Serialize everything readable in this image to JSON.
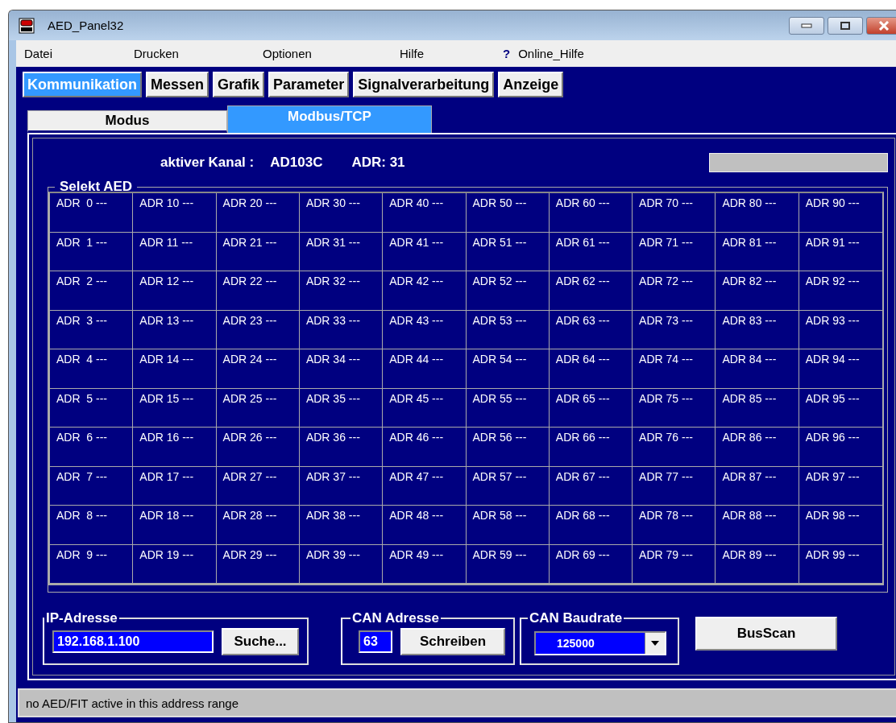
{
  "window": {
    "title": "AED_Panel32"
  },
  "menu": [
    "Datei",
    "Drucken",
    "Optionen",
    "Hilfe"
  ],
  "help_item": {
    "mark": "?",
    "label": "Online_Hilfe"
  },
  "main_tabs": [
    {
      "label": "Kommunikation",
      "selected": true
    },
    {
      "label": "Messen",
      "selected": false
    },
    {
      "label": "Grafik",
      "selected": false
    },
    {
      "label": "Parameter",
      "selected": false
    },
    {
      "label": "Signalverarbeitung",
      "selected": false
    },
    {
      "label": "Anzeige",
      "selected": false
    }
  ],
  "sub_tabs": [
    {
      "label": "Modus",
      "selected": false
    },
    {
      "label": "Modbus/TCP",
      "selected": true
    }
  ],
  "active_channel": {
    "label": "aktiver Kanal :",
    "channel": "AD103C",
    "address": "ADR: 31"
  },
  "address_grid": {
    "title": "Selekt AED",
    "rows": [
      [
        "ADR  0 ---",
        "ADR 10 ---",
        "ADR 20 ---",
        "ADR 30 ---",
        "ADR 40 ---",
        "ADR 50 ---",
        "ADR 60 ---",
        "ADR 70 ---",
        "ADR 80 ---",
        "ADR 90 ---"
      ],
      [
        "ADR  1 ---",
        "ADR 11 ---",
        "ADR 21 ---",
        "ADR 31 ---",
        "ADR 41 ---",
        "ADR 51 ---",
        "ADR 61 ---",
        "ADR 71 ---",
        "ADR 81 ---",
        "ADR 91 ---"
      ],
      [
        "ADR  2 ---",
        "ADR 12 ---",
        "ADR 22 ---",
        "ADR 32 ---",
        "ADR 42 ---",
        "ADR 52 ---",
        "ADR 62 ---",
        "ADR 72 ---",
        "ADR 82 ---",
        "ADR 92 ---"
      ],
      [
        "ADR  3 ---",
        "ADR 13 ---",
        "ADR 23 ---",
        "ADR 33 ---",
        "ADR 43 ---",
        "ADR 53 ---",
        "ADR 63 ---",
        "ADR 73 ---",
        "ADR 83 ---",
        "ADR 93 ---"
      ],
      [
        "ADR  4 ---",
        "ADR 14 ---",
        "ADR 24 ---",
        "ADR 34 ---",
        "ADR 44 ---",
        "ADR 54 ---",
        "ADR 64 ---",
        "ADR 74 ---",
        "ADR 84 ---",
        "ADR 94 ---"
      ],
      [
        "ADR  5 ---",
        "ADR 15 ---",
        "ADR 25 ---",
        "ADR 35 ---",
        "ADR 45 ---",
        "ADR 55 ---",
        "ADR 65 ---",
        "ADR 75 ---",
        "ADR 85 ---",
        "ADR 95 ---"
      ],
      [
        "ADR  6 ---",
        "ADR 16 ---",
        "ADR 26 ---",
        "ADR 36 ---",
        "ADR 46 ---",
        "ADR 56 ---",
        "ADR 66 ---",
        "ADR 76 ---",
        "ADR 86 ---",
        "ADR 96 ---"
      ],
      [
        "ADR  7 ---",
        "ADR 17 ---",
        "ADR 27 ---",
        "ADR 37 ---",
        "ADR 47 ---",
        "ADR 57 ---",
        "ADR 67 ---",
        "ADR 77 ---",
        "ADR 87 ---",
        "ADR 97 ---"
      ],
      [
        "ADR  8 ---",
        "ADR 18 ---",
        "ADR 28 ---",
        "ADR 38 ---",
        "ADR 48 ---",
        "ADR 58 ---",
        "ADR 68 ---",
        "ADR 78 ---",
        "ADR 88 ---",
        "ADR 98 ---"
      ],
      [
        "ADR  9 ---",
        "ADR 19 ---",
        "ADR 29 ---",
        "ADR 39 ---",
        "ADR 49 ---",
        "ADR 59 ---",
        "ADR 69 ---",
        "ADR 79 ---",
        "ADR 89 ---",
        "ADR 99 ---"
      ]
    ]
  },
  "ip_group": {
    "title": "IP-Adresse",
    "value": "192.168.1.100",
    "button": "Suche..."
  },
  "can_address": {
    "title": "CAN Adresse",
    "value": "63",
    "button": "Schreiben"
  },
  "can_baudrate": {
    "title": "CAN Baudrate",
    "value": "125000"
  },
  "busscan_button": "BusScan",
  "status_bar": "no AED/FIT active in this address range"
}
